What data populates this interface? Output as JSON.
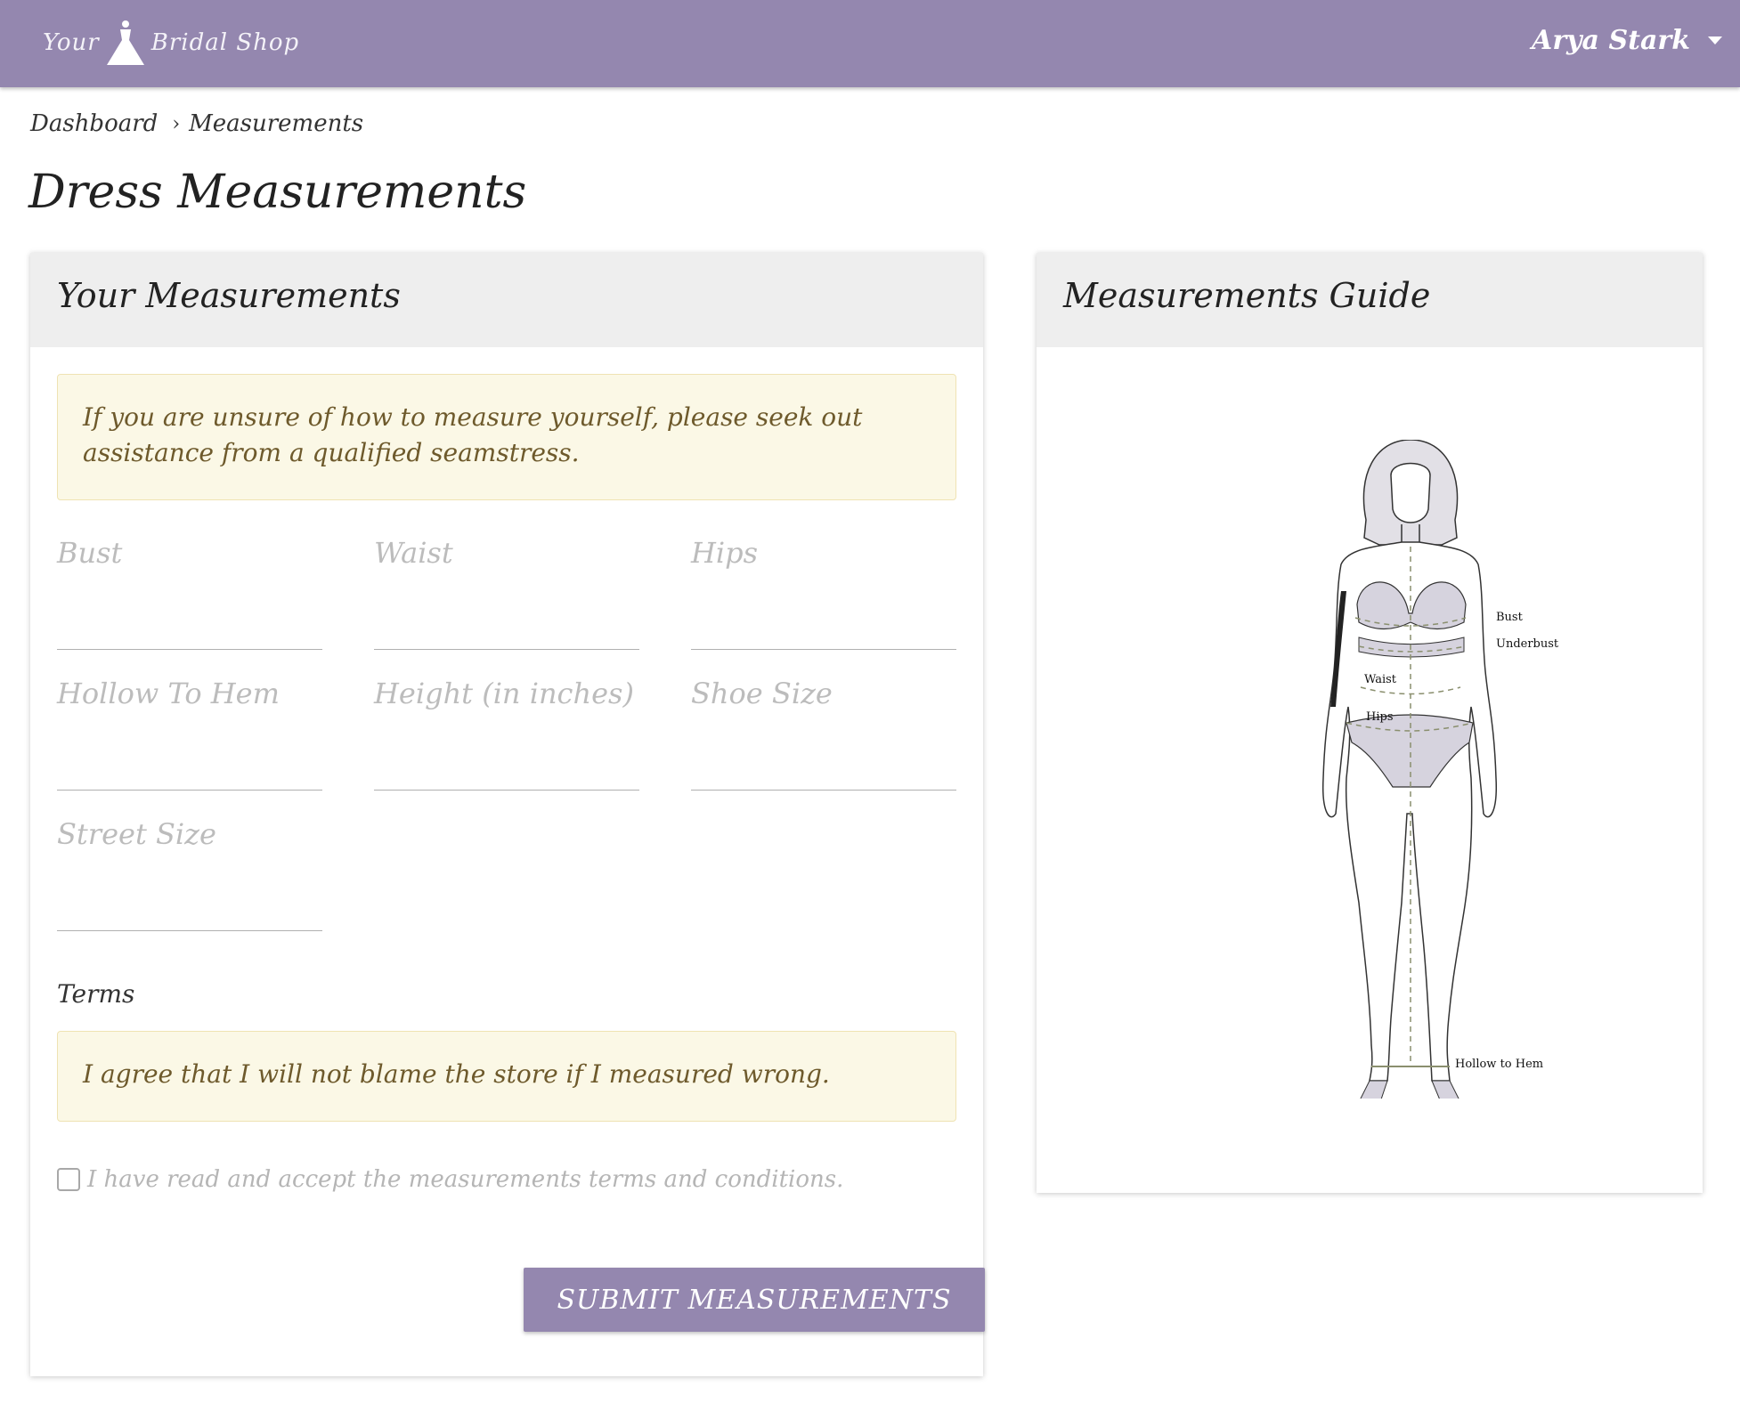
{
  "header": {
    "logo_left": "Your",
    "logo_right": "Bridal Shop",
    "user_name": "Arya Stark"
  },
  "breadcrumb": {
    "items": [
      "Dashboard",
      "Measurements"
    ],
    "separator": "›"
  },
  "page_title": "Dress Measurements",
  "measurements_card": {
    "title": "Your Measurements",
    "notice": "If you are unsure of how to measure yourself, please seek out assistance from a qualified seamstress.",
    "fields": [
      {
        "label": "Bust",
        "value": ""
      },
      {
        "label": "Waist",
        "value": ""
      },
      {
        "label": "Hips",
        "value": ""
      },
      {
        "label": "Hollow To Hem",
        "value": ""
      },
      {
        "label": "Height (in inches)",
        "value": ""
      },
      {
        "label": "Shoe Size",
        "value": ""
      },
      {
        "label": "Street Size",
        "value": ""
      }
    ],
    "terms_label": "Terms",
    "terms_text": "I agree that I will not blame the store if I measured wrong.",
    "accept_label": "I have read and accept the measurements terms and conditions.",
    "accept_checked": false,
    "submit_label": "SUBMIT MEASUREMENTS"
  },
  "guide_card": {
    "title": "Measurements Guide",
    "labels": {
      "bust_right": "Bust",
      "underbust": "Underbust",
      "waist": "Waist",
      "hips": "Hips",
      "hollow_to_hem": "Hollow to Hem"
    }
  },
  "colors": {
    "brand": "#9487af",
    "notice_bg": "#fbf8e6",
    "notice_text": "#6e5a2c"
  }
}
